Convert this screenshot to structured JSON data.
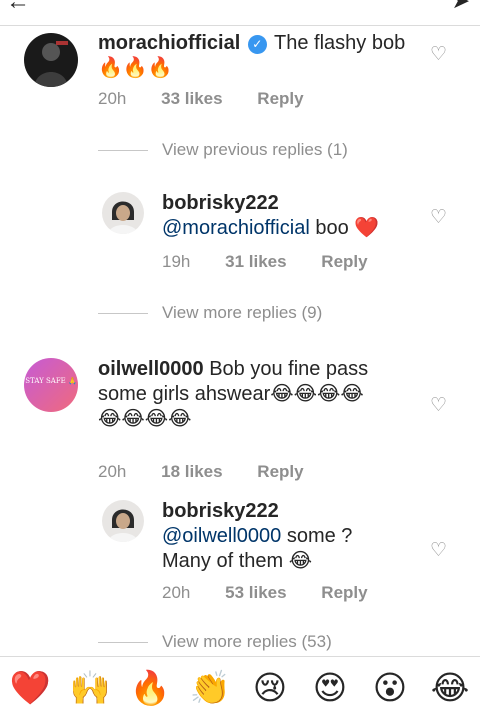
{
  "topbar": {
    "back_icon": "back-arrow-icon",
    "send_icon": "send-icon"
  },
  "comments": [
    {
      "username": "morachiofficial",
      "verified": true,
      "text": "The flashy bob",
      "text2": "🔥🔥🔥",
      "time": "20h",
      "likes": "33 likes",
      "reply": "Reply",
      "avatar": "dark-photo"
    },
    {
      "view_label": "View previous replies (1)"
    },
    {
      "username": "bobrisky222",
      "mention": "@morachiofficial",
      "text": "boo ❤️",
      "time": "19h",
      "likes": "31 likes",
      "reply": "Reply"
    },
    {
      "view_label": "View more replies (9)"
    },
    {
      "username": "oilwell0000",
      "text": "Bob you fine pass",
      "text2": "some girls ahswear😂😂😂😂",
      "text3": "😂😂😂😂",
      "avatar_text": "STAY SAFE 🙏",
      "time": "20h",
      "likes": "18 likes",
      "reply": "Reply"
    },
    {
      "username": "bobrisky222",
      "mention": "@oilwell0000",
      "text": "some ?",
      "text2": "Many of them 😂",
      "time": "20h",
      "likes": "53 likes",
      "reply": "Reply"
    },
    {
      "view_label": "View more replies (53)"
    }
  ],
  "emoji_bar": [
    "❤️",
    "🙌",
    "🔥",
    "👏",
    "😢",
    "😍",
    "😮",
    "😂"
  ],
  "colors": {
    "mention": "#003569",
    "meta": "#8e8e8e",
    "verified": "#3897f0"
  }
}
